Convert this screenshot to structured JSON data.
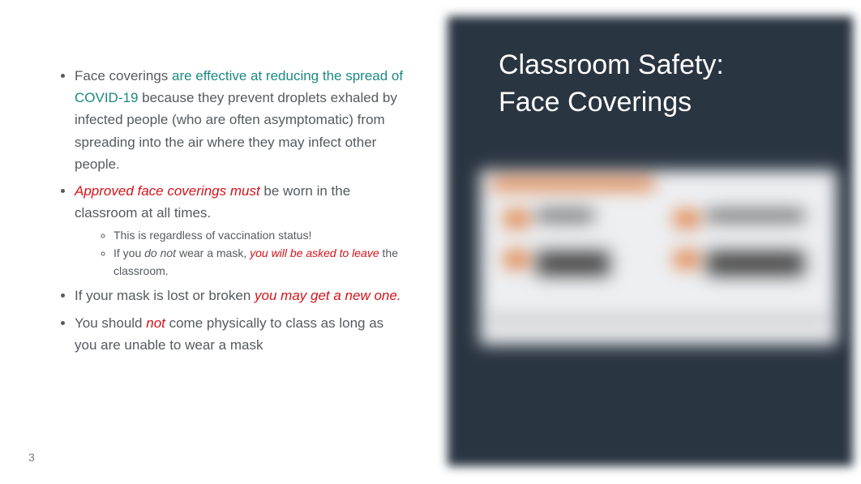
{
  "title_line1": "Classroom Safety:",
  "title_line2": "Face Coverings",
  "bullets": {
    "b1_pre": "Face coverings ",
    "b1_teal": "are effective at reducing the spread of COVID-19",
    "b1_post": " because they prevent droplets exhaled by infected people (who are often asymptomatic) from spreading into the air where they may infect other people.",
    "b2_red": "Approved face coverings must",
    "b2_post": " be worn in the classroom at all times.",
    "b2_sub1": "This is regardless of vaccination status!",
    "b2_sub2_pre": "If you ",
    "b2_sub2_ital": "do not",
    "b2_sub2_mid": " wear a mask, ",
    "b2_sub2_red": "you will be asked to leave",
    "b2_sub2_post": " the classroom.",
    "b3_pre": "If your mask is lost or broken ",
    "b3_red": "you may get a new one.",
    "b4_pre": "You should ",
    "b4_red": "not",
    "b4_post": " come physically to class as long as you are unable to wear a mask"
  },
  "page_number": "3"
}
